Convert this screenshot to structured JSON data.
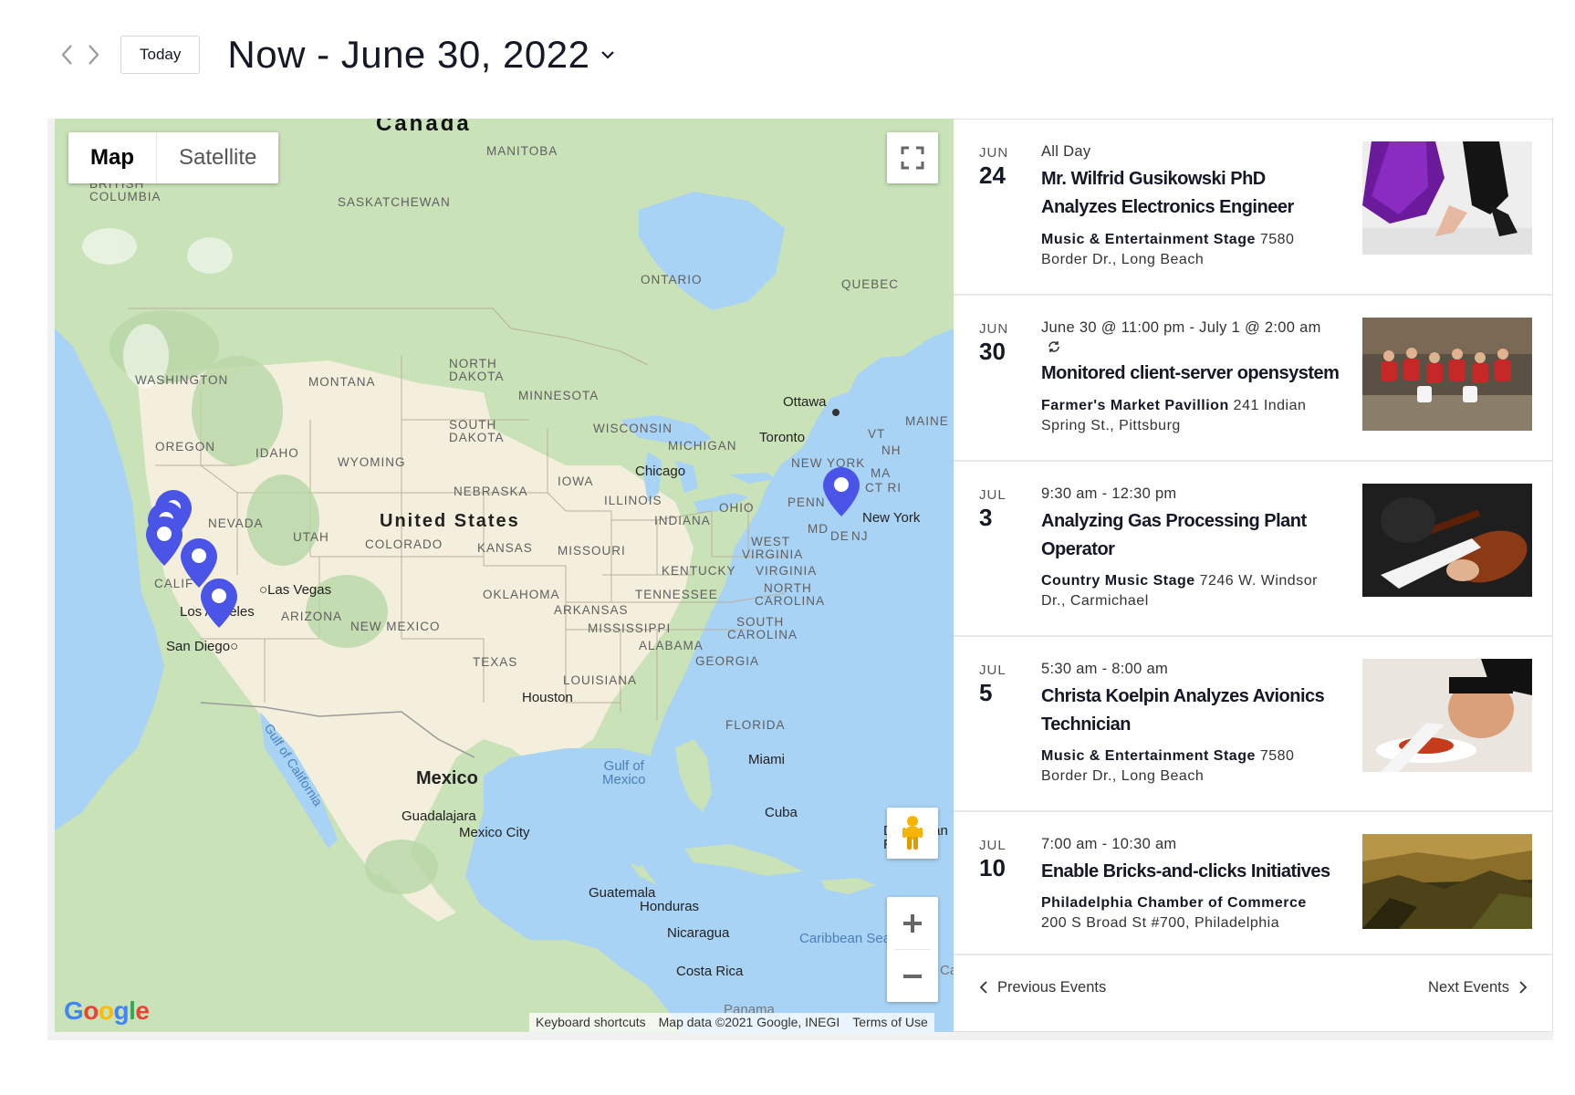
{
  "header": {
    "prev_icon": "chevron-left-icon",
    "next_icon": "chevron-right-icon",
    "today_label": "Today",
    "date_range": "Now - June 30, 2022"
  },
  "map": {
    "type_map": "Map",
    "type_satellite": "Satellite",
    "labels": {
      "canada": "Canada",
      "manitoba": "MANITOBA",
      "british_columbia_1": "BRITISH",
      "british_columbia_2": "COLUMBIA",
      "saskatchewan": "SASKATCHEWAN",
      "ontario": "ONTARIO",
      "quebec": "QUEBEC",
      "washington": "WASHINGTON",
      "montana": "MONTANA",
      "north_dakota_1": "NORTH",
      "north_dakota_2": "DAKOTA",
      "minnesota": "MINNESOTA",
      "oregon": "OREGON",
      "idaho": "IDAHO",
      "south_dakota_1": "SOUTH",
      "south_dakota_2": "DAKOTA",
      "wisconsin": "WISCONSIN",
      "michigan": "MICHIGAN",
      "wyoming": "WYOMING",
      "maine": "MAINE",
      "vt": "VT",
      "nh": "NH",
      "ma": "MA",
      "ct_ri": "CT RI",
      "new_york_state": "NEW YORK",
      "nevada": "NEVADA",
      "utah": "UTAH",
      "united_states": "United States",
      "colorado": "COLORADO",
      "nebraska": "NEBRASKA",
      "iowa": "IOWA",
      "illinois": "ILLINOIS",
      "indiana": "INDIANA",
      "ohio": "OHIO",
      "penn": "PENN",
      "md": "MD",
      "de": "DE",
      "nj": "NJ",
      "kansas": "KANSAS",
      "missouri": "MISSOURI",
      "west_virginia_1": "WEST",
      "west_virginia_2": "VIRGINIA",
      "kentucky": "KENTUCKY",
      "virginia": "VIRGINIA",
      "california": "CALIF",
      "arizona": "ARIZONA",
      "new_mexico": "NEW MEXICO",
      "oklahoma": "OKLAHOMA",
      "arkansas": "ARKANSAS",
      "tennessee": "TENNESSEE",
      "north_carolina_1": "NORTH",
      "north_carolina_2": "CAROLINA",
      "mississippi": "MISSISSIPPI",
      "south_carolina_1": "SOUTH",
      "south_carolina_2": "CAROLINA",
      "alabama": "ALABAMA",
      "georgia": "GEORGIA",
      "texas": "TEXAS",
      "louisiana": "LOUISIANA",
      "florida": "FLORIDA",
      "mexico": "Mexico",
      "gulf_of_mexico_1": "Gulf of",
      "gulf_of_mexico_2": "Mexico",
      "gulf_of_california": "Gulf of California",
      "caribbean_sea": "Caribbean Sea",
      "ottawa": "Ottawa",
      "toronto": "Toronto",
      "chicago": "Chicago",
      "new_york": "New York",
      "las_vegas": "Las Vegas",
      "los_angeles": "Los Angeles",
      "san_diego": "San Diego",
      "houston": "Houston",
      "miami": "Miami",
      "cuba": "Cuba",
      "dominican_republic_1": "Dominican",
      "dominican_republic_2": "Republic",
      "guadalajara": "Guadalajara",
      "mexico_city": "Mexico City",
      "guatemala": "Guatemala",
      "honduras": "Honduras",
      "nicaragua": "Nicaragua",
      "costa_rica": "Costa Rica",
      "panama": "Panama",
      "ca": "Ca"
    },
    "google_letters": [
      "G",
      "o",
      "o",
      "g",
      "l",
      "e"
    ],
    "attribution": {
      "shortcuts": "Keyboard shortcuts",
      "data": "Map data ©2021 Google, INEGI",
      "terms": "Terms of Use"
    },
    "colors": {
      "water": "#a9d3f5",
      "land": "#f4efdc",
      "forest": "#c9e2b8",
      "pin": "#4a55e8"
    }
  },
  "events": [
    {
      "month": "JUN",
      "day": "24",
      "time": "All Day",
      "title": "Mr. Wilfrid Gusikowski PhD Analyzes Electronics Engineer",
      "venue_name": "Music & Entertainment Stage",
      "venue_address": "7580 Border Dr., Long Beach",
      "image": "dancer-photo"
    },
    {
      "month": "JUN",
      "day": "30",
      "time": "June 30 @ 11:00 pm - July 1 @ 2:00 am",
      "recurring_icon": "recurring-icon",
      "title": "Monitored client-server opensystem",
      "venue_name": "Farmer's Market Pavillion",
      "venue_address": "241 Indian Spring St., Pittsburg",
      "image": "group-photo"
    },
    {
      "month": "JUL",
      "day": "3",
      "time": "9:30 am - 12:30 pm",
      "title": "Analyzing Gas Processing Plant Operator",
      "venue_name": "Country Music Stage",
      "venue_address": "7246 W. Windsor Dr., Carmichael",
      "image": "violin-photo"
    },
    {
      "month": "JUL",
      "day": "5",
      "time": "5:30 am - 8:00 am",
      "title": "Christa Koelpin Analyzes Avionics Technician",
      "venue_name": "Music & Entertainment Stage",
      "venue_address": "7580 Border Dr., Long Beach",
      "image": "chef-photo"
    },
    {
      "month": "JUL",
      "day": "10",
      "time": "7:00 am - 10:30 am",
      "title": "Enable Bricks-and-clicks Initiatives",
      "venue_name": "Philadelphia Chamber of Commerce",
      "venue_address": "200 S Broad St #700, Philadelphia",
      "image": "mountain-photo"
    }
  ],
  "pager": {
    "previous": "Previous Events",
    "next": "Next Events"
  }
}
